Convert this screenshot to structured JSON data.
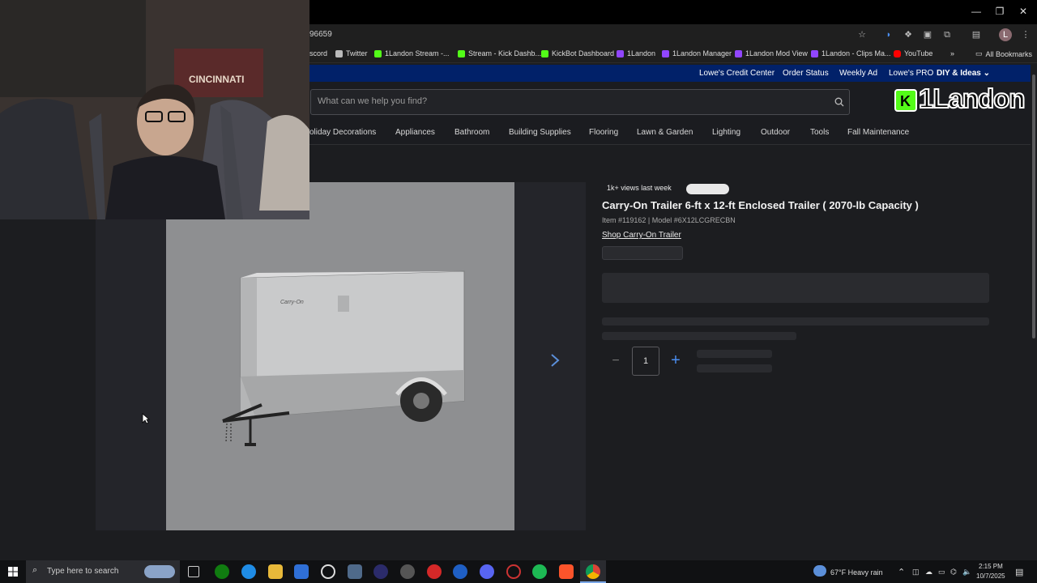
{
  "browser": {
    "url_partial": "96659",
    "bookmarks": [
      {
        "label": "scord",
        "color": "#5865f2"
      },
      {
        "label": "Twitter",
        "color": "#bbbbbb"
      },
      {
        "label": "1Landon Stream -...",
        "color": "#53fc18"
      },
      {
        "label": "Stream - Kick Dashb...",
        "color": "#53fc18"
      },
      {
        "label": "KickBot Dashboard",
        "color": "#53fc18"
      },
      {
        "label": "1Landon",
        "color": "#9146ff"
      },
      {
        "label": "1Landon Manager",
        "color": "#9146ff"
      },
      {
        "label": "1Landon Mod View",
        "color": "#9146ff"
      },
      {
        "label": "1Landon - Clips Ma...",
        "color": "#9146ff"
      },
      {
        "label": "YouTube",
        "color": "#ff0000"
      }
    ],
    "more_bookmarks": "»",
    "all_bookmarks": "All Bookmarks"
  },
  "lowes": {
    "top_links": [
      "Lowe's Credit Center",
      "Order Status",
      "Weekly Ad",
      "Lowe's PRO",
      "DIY & Ideas"
    ],
    "search_placeholder": "What can we help you find?",
    "nav": [
      "oliday Decorations",
      "Appliances",
      "Bathroom",
      "Building Supplies",
      "Flooring",
      "Lawn & Garden",
      "Lighting",
      "Outdoor",
      "Tools",
      "Fall Maintenance"
    ]
  },
  "overlay": {
    "logo_text": "1Landon"
  },
  "product": {
    "views_badge": "1k+ views last week",
    "title": "Carry-On Trailer 6-ft x 12-ft Enclosed Trailer ( 2070-lb Capacity )",
    "item_model": "Item #119162 | Model #6X12LCGRECBN",
    "shop_link": "Shop Carry-On Trailer",
    "quantity": "1",
    "image_brand_text": "Carry-On"
  },
  "taskbar": {
    "search_placeholder": "Type here to search",
    "weather": "67°F  Heavy rain",
    "time": "2:15 PM",
    "date": "10/7/2025"
  },
  "colors": {
    "lowes_blue": "#012169",
    "qty_plus": "#4a8ef0",
    "kick_green": "#53fc18"
  }
}
